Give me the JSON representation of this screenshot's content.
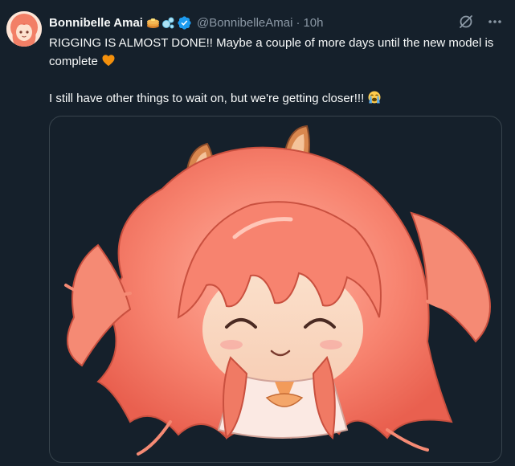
{
  "author": {
    "display_name": "Bonnibelle Amai",
    "handle": "@BonnibelleAmai",
    "separator": "·",
    "time": "10h",
    "name_emojis": [
      "pancake-emoji",
      "bubbles-emoji"
    ],
    "verified": true
  },
  "tweet": {
    "line1": "RIGGING IS ALMOST DONE!! Maybe a couple of more days until the new model is complete",
    "line1_emoji": "orange-heart-emoji",
    "line2": "I still have other things to wait on, but we're getting closer!!!",
    "line2_emoji": "loudly-crying-emoji"
  },
  "actions": {
    "grok_icon": "grok-icon",
    "more_icon": "more-icon"
  },
  "media": {
    "alt": "chibi-character-artwork"
  },
  "colors": {
    "background": "#15202b",
    "text": "#f7f9f9",
    "muted": "#8b98a5",
    "verified": "#1d9bf0",
    "border": "#38444d",
    "hair": "#f48a78"
  }
}
